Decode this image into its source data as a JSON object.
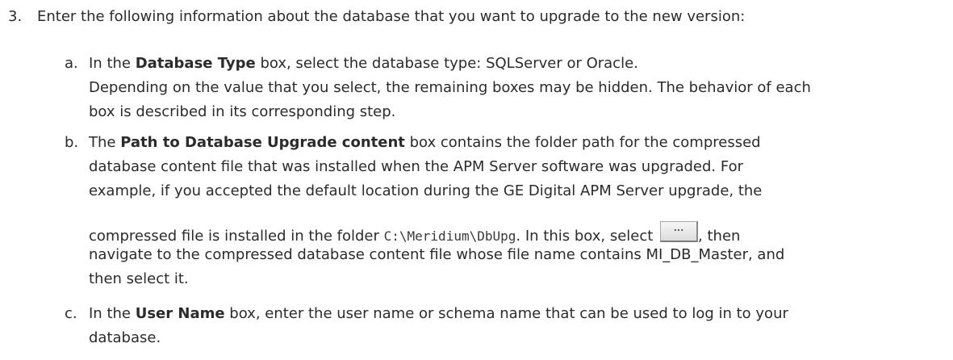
{
  "step3": {
    "number": "3.",
    "text": "Enter the following information about the database that you want to upgrade to the new version:"
  },
  "sub_a": {
    "letter": "a.",
    "pre": "In the ",
    "bold": "Database Type",
    "post": " box, select the database type: SQLServer or Oracle.",
    "note_line1": "Depending on the value that you select, the remaining boxes may be hidden. The behavior of each",
    "note_line2": "box is described in its corresponding step."
  },
  "sub_b": {
    "letter": "b.",
    "line1_pre": "The ",
    "line1_bold": "Path to Database Upgrade content",
    "line1_post": " box contains the folder path for the compressed",
    "line2": "database content file that was installed when the APM Server software was upgraded. For",
    "line3": "example, if you accepted the default location during the GE Digital APM Server upgrade, the",
    "line4_pre": "compressed file is installed in the folder ",
    "line4_code": "C:\\Meridium\\DbUpg",
    "line4_mid": ". In this box, select ",
    "browse_button_label": "...",
    "line4_post": ", then",
    "line5": "navigate to the compressed database content file whose file name contains MI_DB_Master, and",
    "line6": "then select it."
  },
  "sub_c": {
    "letter": "c.",
    "pre": "In the ",
    "bold": "User Name",
    "post": " box, enter the user name or schema name that can be used to log in to your",
    "line2": "database."
  }
}
